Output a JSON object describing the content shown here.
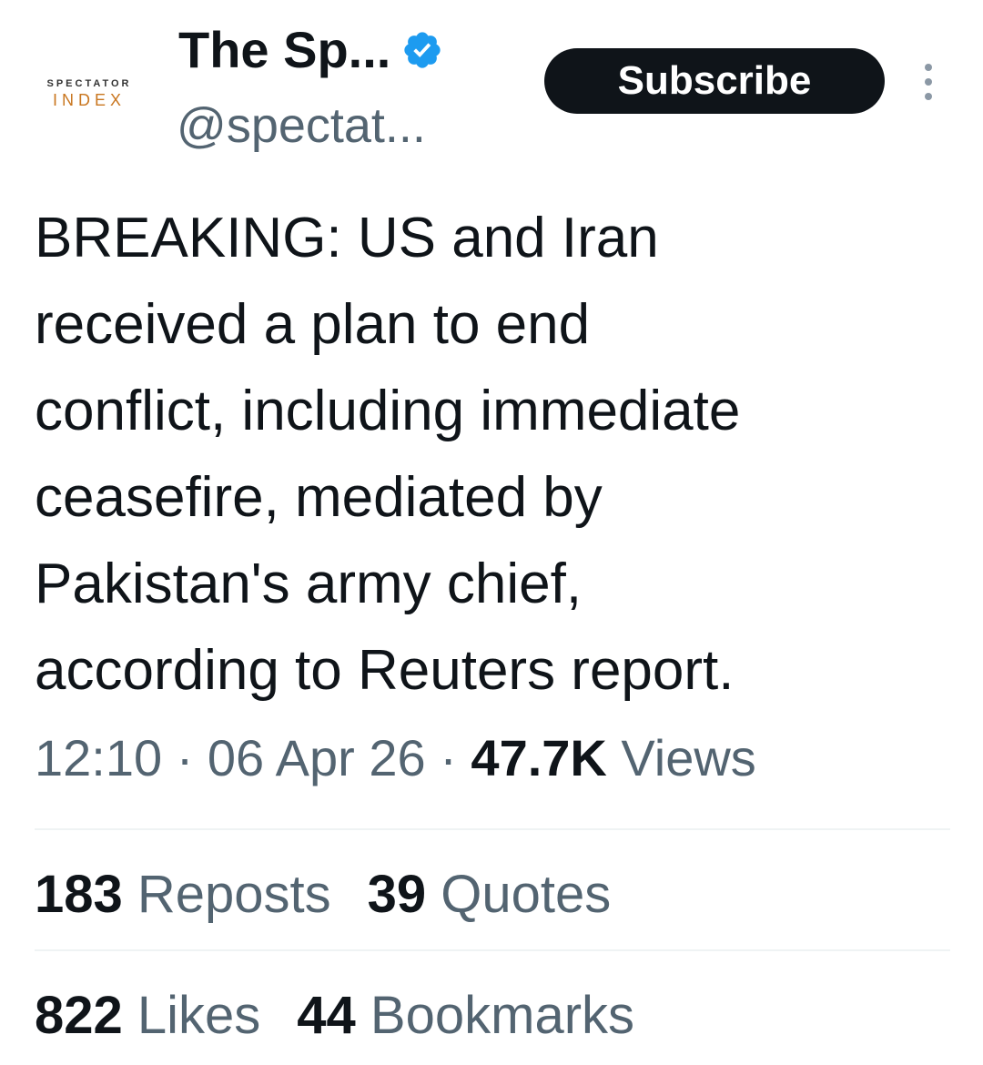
{
  "account": {
    "avatar_top": "SPECTATOR",
    "avatar_bottom": "INDEX",
    "display_name": "The Sp...",
    "handle": "@spectat..."
  },
  "actions": {
    "subscribe_label": "Subscribe"
  },
  "tweet": {
    "text": "BREAKING: US and Iran\nreceived a plan to end\nconflict, including immediate\nceasefire, mediated by\nPakistan's army chief,\naccording to Reuters report.",
    "time": "12:10",
    "separator": " · ",
    "date": "06 Apr 26",
    "views_count": "47.7K",
    "views_label": " Views"
  },
  "stats": {
    "reposts_count": "183",
    "reposts_label": " Reposts",
    "quotes_count": "39",
    "quotes_label": " Quotes",
    "likes_count": "822",
    "likes_label": " Likes",
    "bookmarks_count": "44",
    "bookmarks_label": " Bookmarks"
  },
  "colors": {
    "text_primary": "#0f1419",
    "text_secondary": "#536471",
    "verified": "#1d9bf0",
    "avatar_accent": "#c9761f",
    "divider": "#eff3f4"
  },
  "icons": {
    "verified": "verified-badge-icon",
    "more": "more-vertical-icon"
  }
}
